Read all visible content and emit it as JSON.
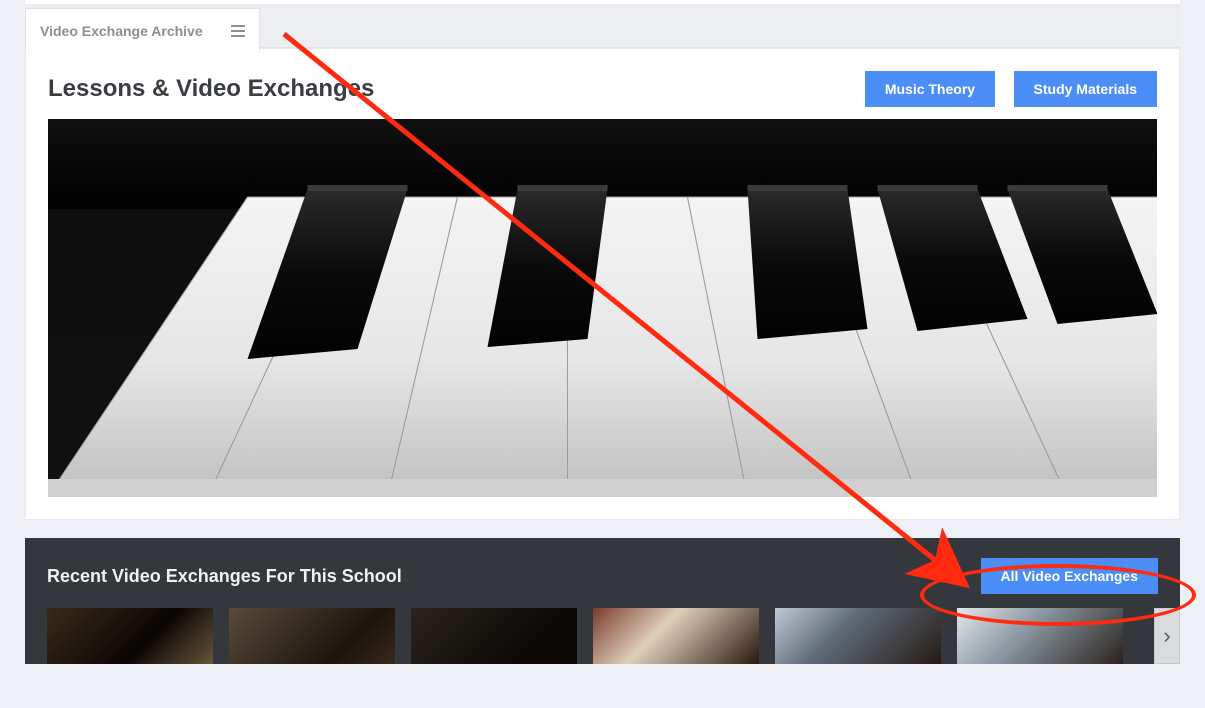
{
  "tabs": {
    "archive": "Video Exchange Archive"
  },
  "card": {
    "title": "Lessons & Video Exchanges",
    "buttons": {
      "music_theory": "Music Theory",
      "study_materials": "Study Materials"
    }
  },
  "recent": {
    "title": "Recent Video Exchanges For This School",
    "all_button": "All Video Exchanges",
    "next_glyph": "›"
  },
  "icons": {
    "menu": "menu-icon"
  }
}
